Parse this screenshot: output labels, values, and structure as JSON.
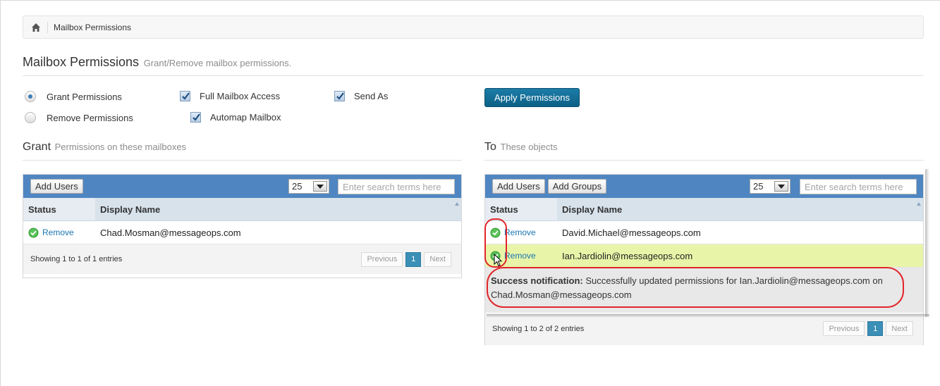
{
  "breadcrumb": {
    "current": "Mailbox Permissions"
  },
  "page": {
    "title": "Mailbox Permissions",
    "subtitle": "Grant/Remove mailbox permissions."
  },
  "options": {
    "grant_permissions": "Grant Permissions",
    "remove_permissions": "Remove Permissions",
    "full_mailbox_access": "Full Mailbox Access",
    "automap_mailbox": "Automap Mailbox",
    "send_as": "Send As",
    "selected_mode": "Grant Permissions",
    "apply_button": "Apply Permissions"
  },
  "grant": {
    "title": "Grant",
    "subtitle": "Permissions on these mailboxes",
    "add_users": "Add Users",
    "page_size": "25",
    "search_placeholder": "Enter search terms here",
    "columns": {
      "status": "Status",
      "name": "Display Name"
    },
    "rows": [
      {
        "status": "Remove",
        "name": "Chad.Mosman@messageops.com"
      }
    ],
    "info": "Showing 1 to 1 of 1 entries",
    "pager": {
      "previous": "Previous",
      "page": "1",
      "next": "Next"
    }
  },
  "to": {
    "title": "To",
    "subtitle": "These objects",
    "add_users": "Add Users",
    "add_groups": "Add Groups",
    "page_size": "25",
    "search_placeholder": "Enter search terms here",
    "columns": {
      "status": "Status",
      "name": "Display Name"
    },
    "rows": [
      {
        "status": "Remove",
        "name": "David.Michael@messageops.com"
      },
      {
        "status": "Remove",
        "name": "Ian.Jardiolin@messageops.com"
      }
    ],
    "notification": {
      "label": "Success notification:",
      "line1": "Successfully updated permissions for Ian.Jardiolin@messageops.com on",
      "line2": "Chad.Mosman@messageops.com"
    },
    "info": "Showing 1 to 2 of 2 entries",
    "pager": {
      "previous": "Previous",
      "page": "1",
      "next": "Next"
    }
  },
  "colors": {
    "toolbar": "#4f86c1",
    "apply_button": "#0c5f86",
    "link": "#1a75b0",
    "highlight_row": "#e8f5a8",
    "annotation": "#e2262a"
  }
}
